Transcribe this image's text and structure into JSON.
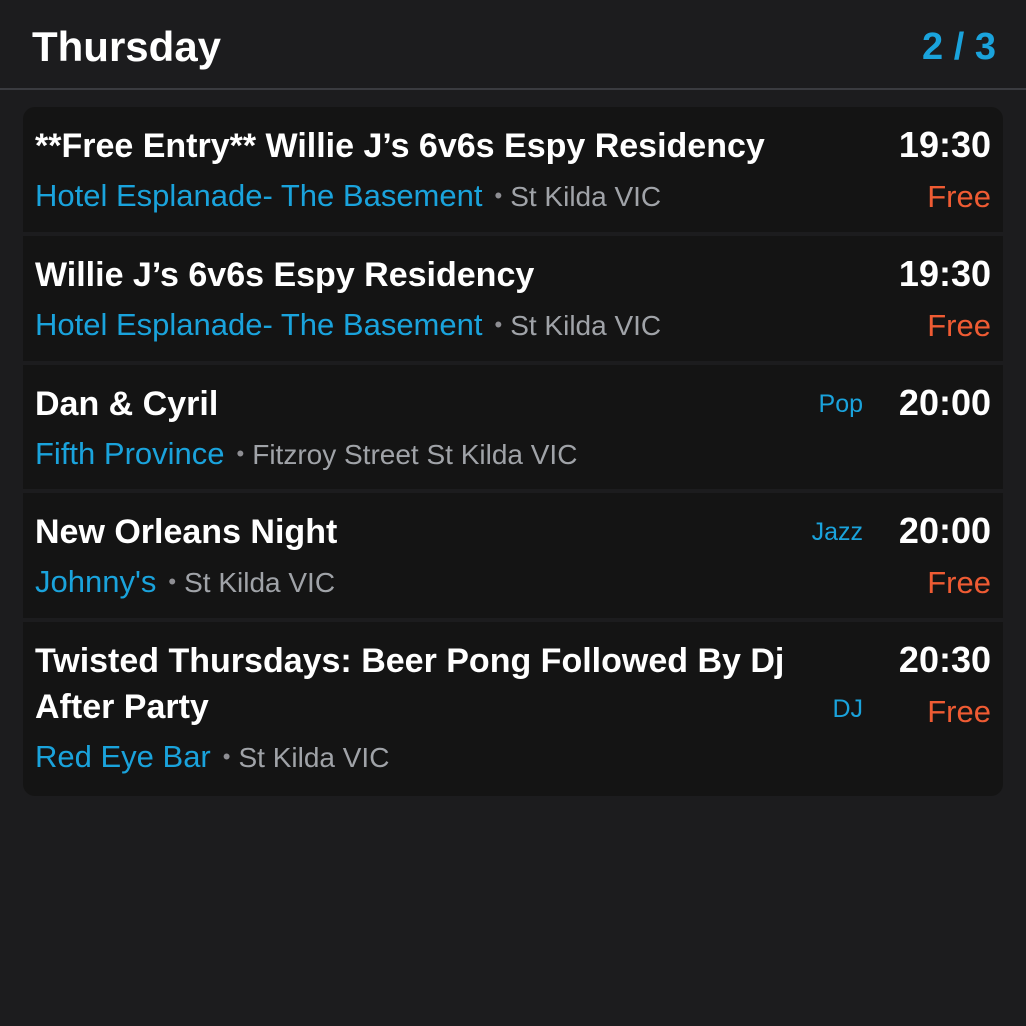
{
  "header": {
    "title": "Thursday",
    "pager": "2 / 3"
  },
  "colors": {
    "background": "#1c1c1e",
    "card": "#141414",
    "accent": "#1aa3dc",
    "price": "#ef5b33",
    "muted": "#a0a3a8"
  },
  "separator": "•",
  "events": [
    {
      "name": "**Free Entry** Willie J’s 6v6s Espy Residency",
      "time": "19:30",
      "genre": "",
      "venue": "Hotel Esplanade- The Basement",
      "location": "St Kilda VIC",
      "price": "Free"
    },
    {
      "name": "Willie J’s 6v6s Espy Residency",
      "time": "19:30",
      "genre": "",
      "venue": "Hotel Esplanade- The Basement",
      "location": "St Kilda VIC",
      "price": "Free"
    },
    {
      "name": "Dan & Cyril",
      "time": "20:00",
      "genre": "Pop",
      "venue": "Fifth Province",
      "location": "Fitzroy Street St Kilda VIC",
      "price": ""
    },
    {
      "name": "New Orleans Night",
      "time": "20:00",
      "genre": "Jazz",
      "venue": "Johnny's",
      "location": "St Kilda VIC",
      "price": "Free"
    },
    {
      "name": "Twisted Thursdays: Beer Pong Followed By Dj After Party",
      "time": "20:30",
      "genre": "DJ",
      "venue": "Red Eye Bar",
      "location": "St Kilda VIC",
      "price": "Free"
    }
  ]
}
